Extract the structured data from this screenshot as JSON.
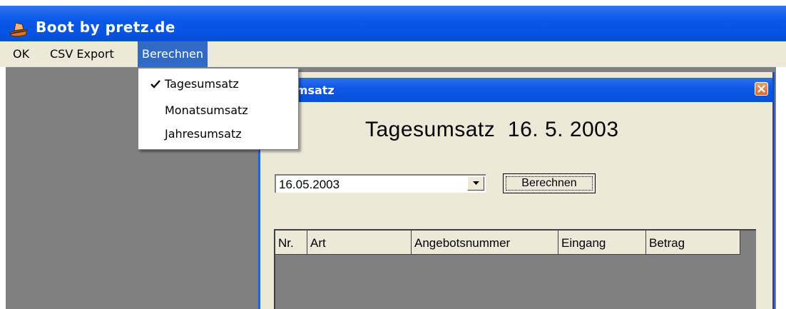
{
  "window": {
    "title": "Boot by pretz.de"
  },
  "menubar": {
    "items": [
      {
        "label": "OK"
      },
      {
        "label": "CSV Export"
      },
      {
        "label": "Berechnen"
      }
    ]
  },
  "dropdown": {
    "items": [
      {
        "label": "Tagesumsatz",
        "checked": true
      },
      {
        "label": "Monatsumsatz",
        "checked": false
      },
      {
        "label": "Jahresumsatz",
        "checked": false
      }
    ]
  },
  "child_window": {
    "title": "esumsatz",
    "heading": {
      "label": "Tagesumsatz",
      "date": "16. 5. 2003"
    },
    "date_combo": {
      "value": "16.05.2003"
    },
    "calculate_button": "Berechnen",
    "table": {
      "columns": [
        "Nr.",
        "Art",
        "Angebotsnummer",
        "Eingang",
        "Betrag"
      ],
      "rows": []
    }
  },
  "colors": {
    "titlebar": "#0a59e8",
    "menu_highlight": "#316ac5",
    "window_face": "#ece9d8",
    "mdi_background": "#808080"
  }
}
